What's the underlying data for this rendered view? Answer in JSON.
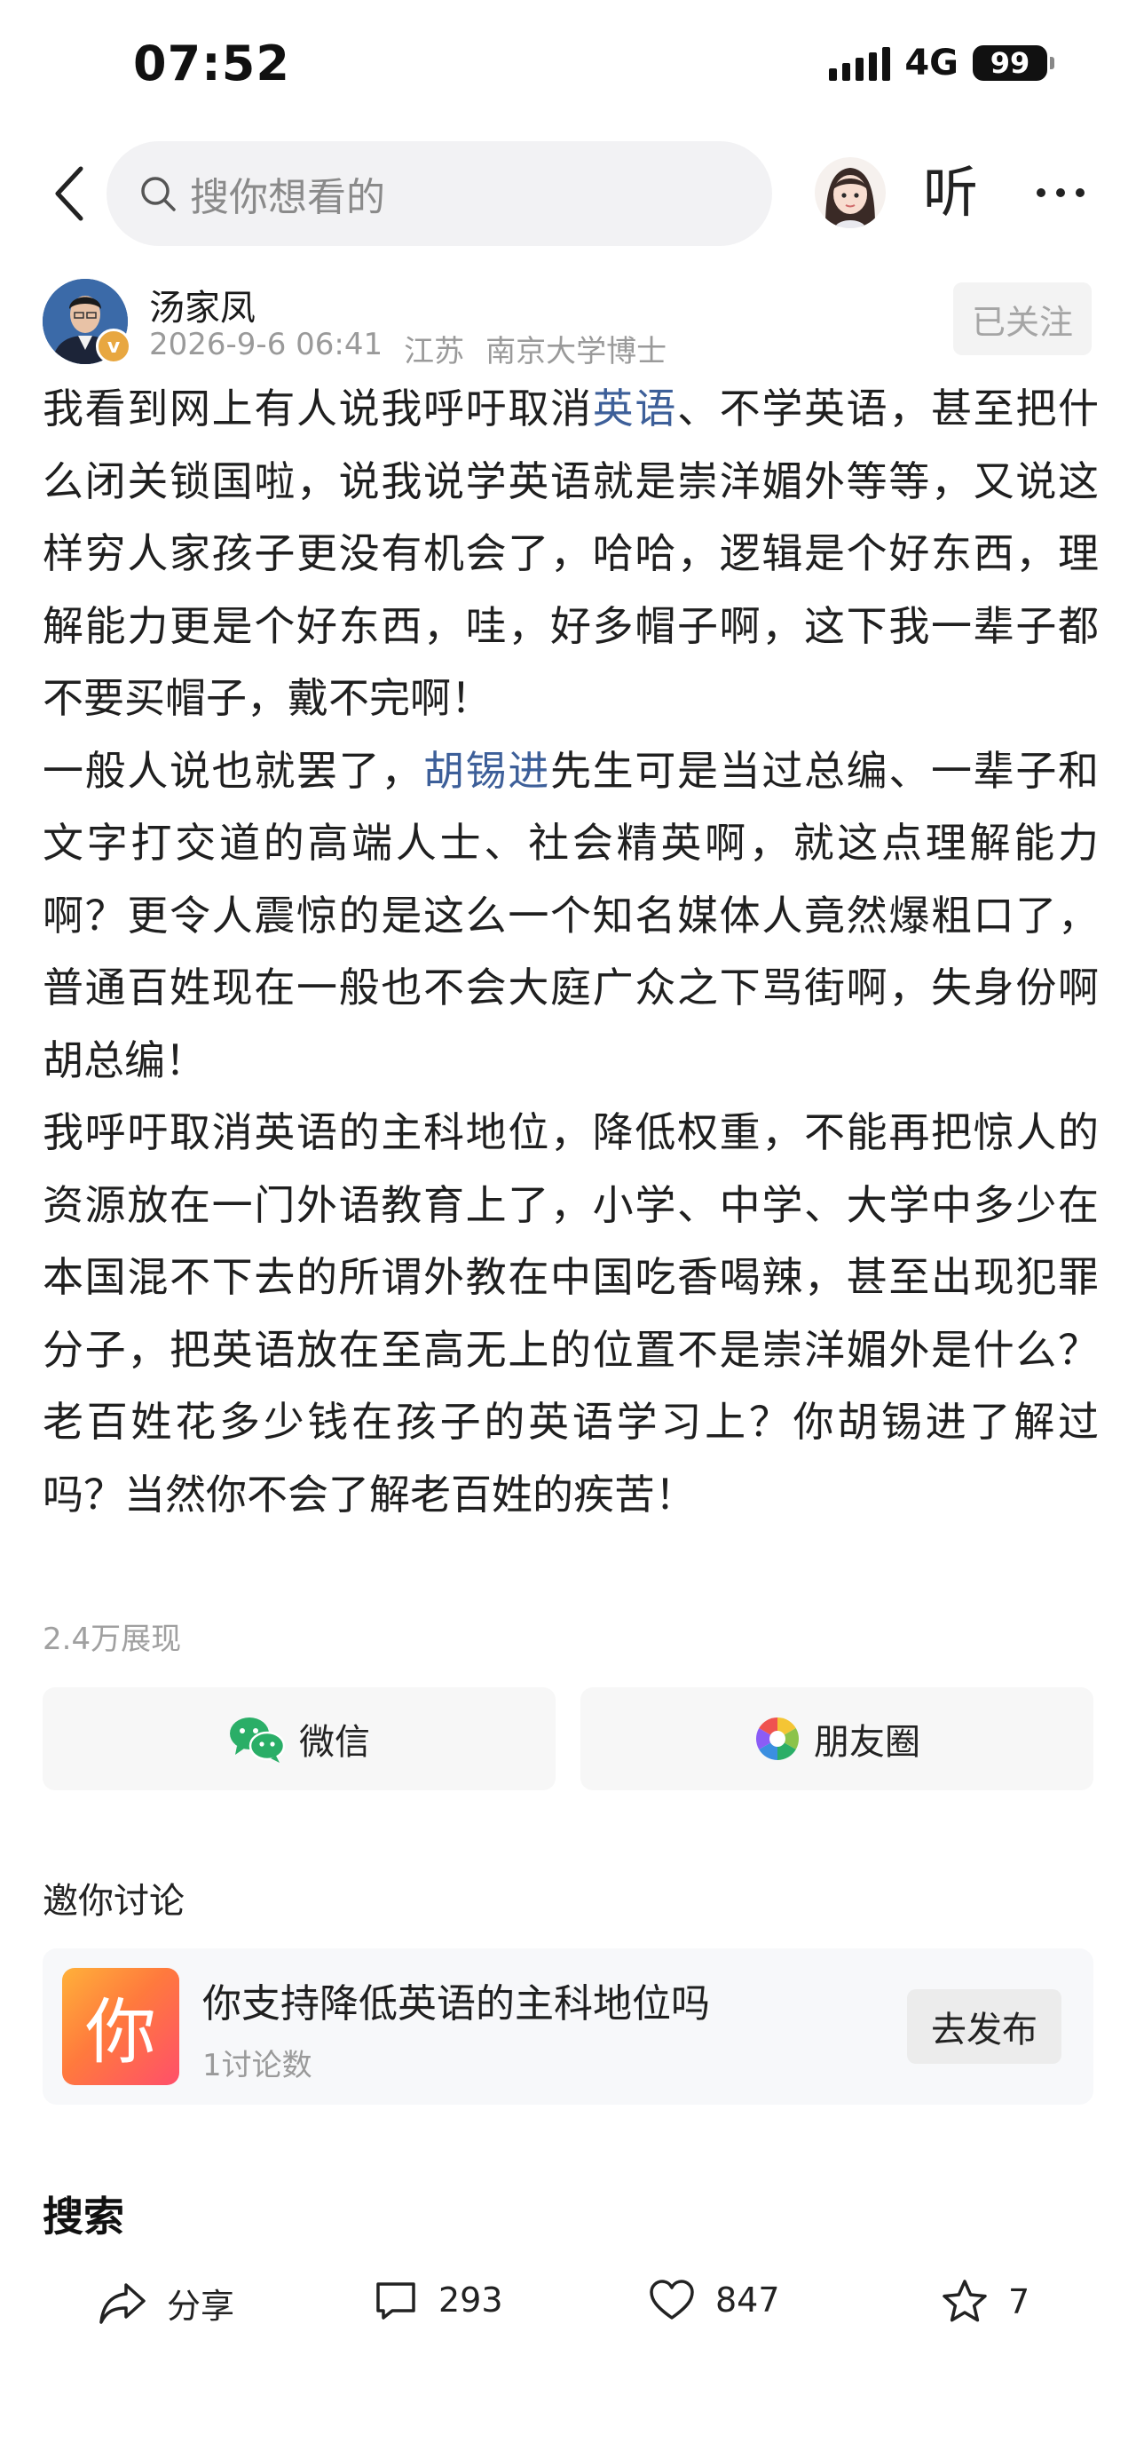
{
  "status_bar": {
    "time": "07:52",
    "network": "4G",
    "battery": "99"
  },
  "nav": {
    "search_placeholder": "搜你想看的",
    "listen_label": "听"
  },
  "author": {
    "name": "汤家凤",
    "verify_mark": "v",
    "date": "2026-9-6 06:41",
    "location": "江苏",
    "title": "南京大学博士",
    "follow_label": "已关注"
  },
  "article": {
    "p1_before": "我看到网上有人说我呼吁取消",
    "p1_link": "英语",
    "p1_after": "、不学英语，甚至把什么闭关锁国啦，说我说学英语就是崇洋媚外等等，又说这样穷人家孩子更没有机会了，哈哈，逻辑是个好东西，理解能力更是个好东西，哇，好多帽子啊，这下我一辈子都不要买帽子，戴不完啊！",
    "p2_before": "一般人说也就罢了，",
    "p2_link": "胡锡进",
    "p2_after": "先生可是当过总编、一辈子和文字打交道的高端人士、社会精英啊，就这点理解能力啊？更令人震惊的是这么一个知名媒体人竟然爆粗口了，普通百姓现在一般也不会大庭广众之下骂街啊，失身份啊胡总编！",
    "p3": "我呼吁取消英语的主科地位，降低权重，不能再把惊人的资源放在一门外语教育上了，小学、中学、大学中多少在本国混不下去的所谓外教在中国吃香喝辣，甚至出现犯罪分子，把英语放在至高无上的位置不是崇洋媚外是什么？老百姓花多少钱在孩子的英语学习上？你胡锡进了解过吗？当然你不会了解老百姓的疾苦！"
  },
  "views": "2.4万展现",
  "share": {
    "wechat_label": "微信",
    "moments_label": "朋友圈"
  },
  "discussion": {
    "heading": "邀你讨论",
    "icon_char": "你",
    "topic": "你支持降低英语的主科地位吗",
    "count": "1讨论数",
    "publish_label": "去发布"
  },
  "search_heading": "搜索",
  "bottom_bar": {
    "share_label": "分享",
    "comments": "293",
    "likes": "847",
    "favorites": "7"
  },
  "colors": {
    "link": "#3d5f99",
    "wechat_green": "#2aae67",
    "badge_gold": "#e8a740"
  }
}
